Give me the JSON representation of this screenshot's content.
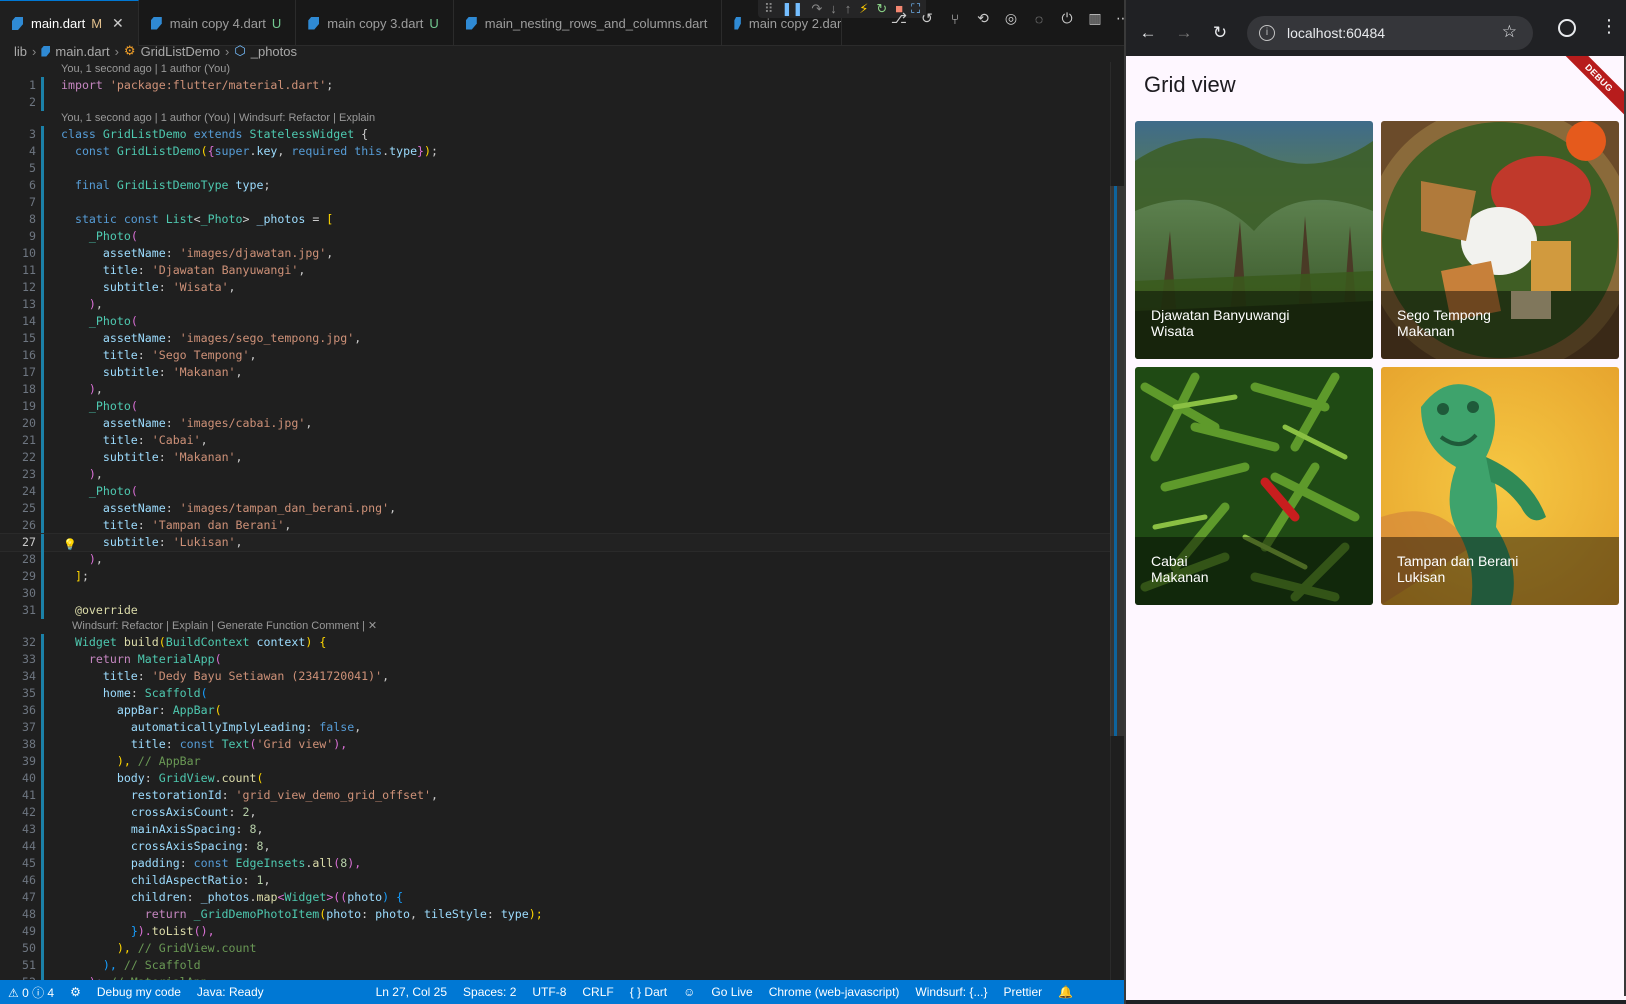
{
  "editor": {
    "tabs": [
      {
        "label": "main.dart",
        "badge": "M",
        "close": "✕"
      },
      {
        "label": "main copy 4.dart",
        "badge": "U"
      },
      {
        "label": "main copy 3.dart",
        "badge": "U"
      },
      {
        "label": "main_nesting_rows_and_columns.dart",
        "badge": ""
      },
      {
        "label": "main copy 2.dar",
        "badge": ""
      }
    ],
    "debug_icons": [
      "⠿",
      "❚❚",
      "↷",
      "↓",
      "↑",
      "⚡",
      "↻",
      "■",
      "⛶"
    ],
    "action_icons": [
      "⎇",
      "↺",
      "⑂",
      "⟲",
      "◎",
      "◌",
      "⏻",
      "▥",
      "⋯"
    ],
    "breadcrumb": [
      "lib",
      "main.dart",
      "GridListDemo",
      "_photos"
    ],
    "codelens_blame_1": "You, 1 second ago | 1 author (You)",
    "codelens_blame_2": "You, 1 second ago | 1 author (You) | Windsurf: Refactor | Explain",
    "codelens_windsurf": "Windsurf: Refactor | Explain | Generate Function Comment | ✕",
    "lines": {
      "l1": [
        "import ",
        "'package:flutter/material.dart'",
        ";"
      ],
      "l3": [
        "class ",
        "GridListDemo",
        " extends ",
        "StatelessWidget",
        " {"
      ],
      "l4": [
        "  const ",
        "GridListDemo",
        "(",
        "{",
        "super",
        ".",
        "key",
        ", ",
        "required ",
        "this",
        ".",
        "type",
        "}",
        ")",
        ";"
      ],
      "l6": [
        "  final ",
        "GridListDemoType",
        " ",
        "type",
        ";"
      ],
      "l8": [
        "  static const ",
        "List",
        "<",
        "_Photo",
        "> ",
        "_photos",
        " = ",
        "["
      ],
      "l9": [
        "    ",
        "_Photo",
        "("
      ],
      "l10": [
        "      ",
        "assetName",
        ": ",
        "'images/djawatan.jpg'",
        ","
      ],
      "l11": [
        "      ",
        "title",
        ": ",
        "'Djawatan Banyuwangi'",
        ","
      ],
      "l12": [
        "      ",
        "subtitle",
        ": ",
        "'Wisata'",
        ","
      ],
      "l13": [
        "    ",
        ")",
        ","
      ],
      "l14": [
        "    ",
        "_Photo",
        "("
      ],
      "l15": [
        "      ",
        "assetName",
        ": ",
        "'images/sego_tempong.jpg'",
        ","
      ],
      "l16": [
        "      ",
        "title",
        ": ",
        "'Sego Tempong'",
        ","
      ],
      "l17": [
        "      ",
        "subtitle",
        ": ",
        "'Makanan'",
        ","
      ],
      "l18": [
        "    ",
        ")",
        ","
      ],
      "l19": [
        "    ",
        "_Photo",
        "("
      ],
      "l20": [
        "      ",
        "assetName",
        ": ",
        "'images/cabai.jpg'",
        ","
      ],
      "l21": [
        "      ",
        "title",
        ": ",
        "'Cabai'",
        ","
      ],
      "l22": [
        "      ",
        "subtitle",
        ": ",
        "'Makanan'",
        ","
      ],
      "l23": [
        "    ",
        ")",
        ","
      ],
      "l24": [
        "    ",
        "_Photo",
        "("
      ],
      "l25": [
        "      ",
        "assetName",
        ": ",
        "'images/tampan_dan_berani.png'",
        ","
      ],
      "l26": [
        "      ",
        "title",
        ": ",
        "'Tampan dan Berani'",
        ","
      ],
      "l27": [
        "      ",
        "subtitle",
        ": ",
        "'Lukisan'",
        ","
      ],
      "l28": [
        "    ",
        ")",
        ","
      ],
      "l29": [
        "  ",
        "]",
        ";"
      ],
      "l31": [
        "  ",
        "@override"
      ],
      "l32": [
        "  ",
        "Widget",
        " ",
        "build",
        "(",
        "BuildContext",
        " ",
        "context",
        ") {"
      ],
      "l33": [
        "    ",
        "return ",
        "MaterialApp",
        "("
      ],
      "l34": [
        "      ",
        "title",
        ": ",
        "'Dedy Bayu Setiawan (2341720041)'",
        ","
      ],
      "l35": [
        "      ",
        "home",
        ": ",
        "Scaffold",
        "("
      ],
      "l36": [
        "        ",
        "appBar",
        ": ",
        "AppBar",
        "("
      ],
      "l37": [
        "          ",
        "automaticallyImplyLeading",
        ": ",
        "false",
        ","
      ],
      "l38": [
        "          ",
        "title",
        ": ",
        "const ",
        "Text",
        "(",
        "'Grid view'",
        "),"
      ],
      "l39": [
        "        ",
        "),",
        " // AppBar"
      ],
      "l40": [
        "        ",
        "body",
        ": ",
        "GridView",
        ".",
        "count",
        "("
      ],
      "l41": [
        "          ",
        "restorationId",
        ": ",
        "'grid_view_demo_grid_offset'",
        ","
      ],
      "l42": [
        "          ",
        "crossAxisCount",
        ": ",
        "2",
        ","
      ],
      "l43": [
        "          ",
        "mainAxisSpacing",
        ": ",
        "8",
        ","
      ],
      "l44": [
        "          ",
        "crossAxisSpacing",
        ": ",
        "8",
        ","
      ],
      "l45": [
        "          ",
        "padding",
        ": ",
        "const ",
        "EdgeInsets",
        ".",
        "all",
        "(",
        "8",
        "),"
      ],
      "l46": [
        "          ",
        "childAspectRatio",
        ": ",
        "1",
        ","
      ],
      "l47": [
        "          ",
        "children",
        ": ",
        "_photos",
        ".",
        "map",
        "<",
        "Widget",
        ">((",
        "photo",
        ") {"
      ],
      "l48": [
        "            ",
        "return ",
        "_GridDemoPhotoItem",
        "(",
        "photo",
        ": ",
        "photo",
        ", ",
        "tileStyle",
        ": ",
        "type",
        ");"
      ],
      "l49": [
        "          ",
        "}",
        ").",
        "toList",
        "(),"
      ],
      "l50": [
        "        ",
        "),",
        " // GridView.count"
      ],
      "l51": [
        "      ",
        "),",
        " // Scaffold"
      ],
      "l52": [
        "    ",
        ");",
        " // MaterialApp"
      ]
    },
    "status": {
      "problems": "⚠ 0 ⓘ 4",
      "debug_icon": "⚙",
      "debug": "Debug my code",
      "java": "Java: Ready",
      "cursor": "Ln 27, Col 25",
      "spaces": "Spaces: 2",
      "encoding": "UTF-8",
      "eol": "CRLF",
      "language": "{ } Dart",
      "copilot_icon": "☺",
      "golive": "Go Live",
      "device": "Chrome (web-javascript)",
      "windsurf": "Windsurf: {...}",
      "prettier": "Prettier",
      "bell_icon": "🔔"
    }
  },
  "browser": {
    "url": "localhost:60484",
    "back_icon": "←",
    "forward_icon": "→",
    "reload_icon": "↻",
    "info_icon": "i",
    "star_icon": "☆",
    "menu_icon": "⋮",
    "app_title": "Grid view",
    "debug_banner": "DEBUG",
    "tiles": [
      {
        "title": "Djawatan Banyuwangi",
        "subtitle": "Wisata"
      },
      {
        "title": "Sego Tempong",
        "subtitle": "Makanan"
      },
      {
        "title": "Cabai",
        "subtitle": "Makanan"
      },
      {
        "title": "Tampan dan Berani",
        "subtitle": "Lukisan"
      }
    ]
  },
  "colors": {
    "status_bar": "#0078d4",
    "app_background": "#fef7ff",
    "debug_banner": "#b71c1c"
  }
}
